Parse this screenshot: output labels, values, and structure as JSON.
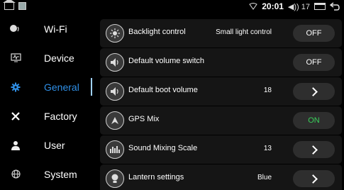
{
  "statusbar": {
    "time": "20:01",
    "volume": "◀)) 17"
  },
  "sidebar": {
    "items": [
      {
        "label": "Wi-Fi",
        "icon": "wifi-icon"
      },
      {
        "label": "Device",
        "icon": "device-icon"
      },
      {
        "label": "General",
        "icon": "gear-icon",
        "active": true
      },
      {
        "label": "Factory",
        "icon": "tools-icon"
      },
      {
        "label": "User",
        "icon": "user-icon"
      },
      {
        "label": "System",
        "icon": "globe-icon"
      }
    ]
  },
  "settings": [
    {
      "label": "Backlight control",
      "value": "Small light control",
      "control": "OFF",
      "icon": "backlight-icon"
    },
    {
      "label": "Default volume switch",
      "value": "",
      "control": "OFF",
      "icon": "speaker-icon"
    },
    {
      "label": "Default boot volume",
      "value": "18",
      "control": "chevron",
      "icon": "speaker-icon"
    },
    {
      "label": "GPS Mix",
      "value": "",
      "control": "ON",
      "icon": "gps-icon"
    },
    {
      "label": "Sound Mixing Scale",
      "value": "13",
      "control": "chevron",
      "icon": "mixer-icon"
    },
    {
      "label": "Lantern settings",
      "value": "Blue",
      "control": "chevron",
      "icon": "lantern-icon"
    }
  ],
  "colors": {
    "accent": "#2f8fe6",
    "on": "#39d05a"
  }
}
